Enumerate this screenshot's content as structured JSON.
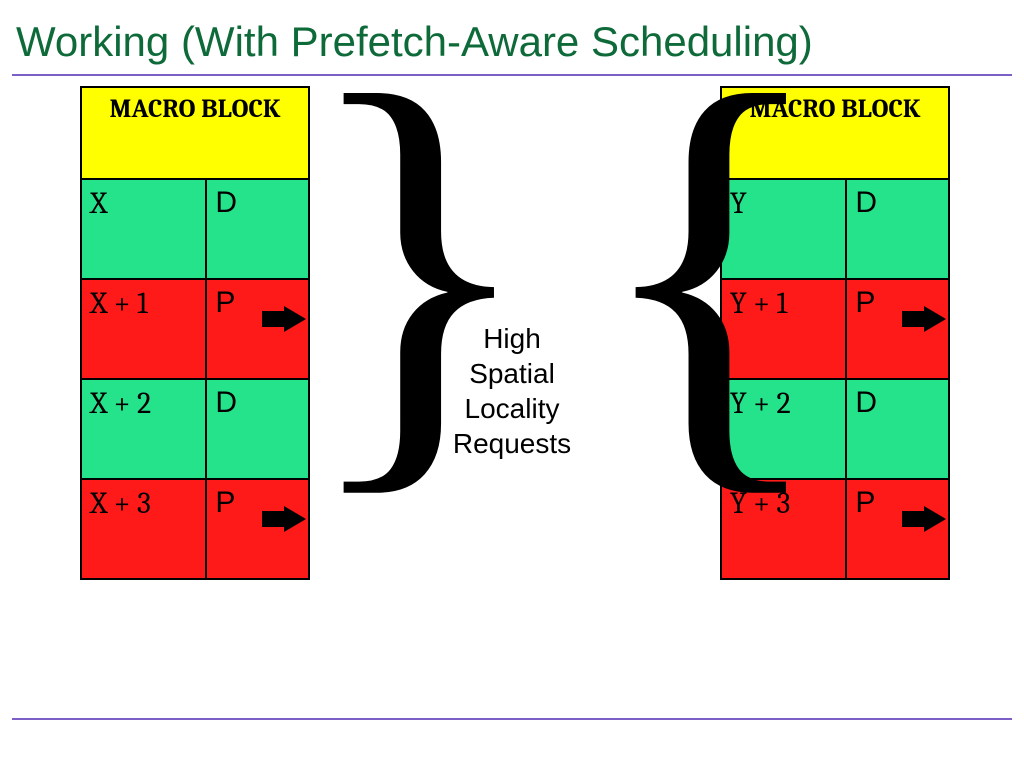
{
  "title": "Working (With Prefetch-Aware Scheduling)",
  "center_label": {
    "l1": "High",
    "l2": "Spatial",
    "l3": "Locality",
    "l4": "Requests"
  },
  "left": {
    "header": "MACRO BLOCK",
    "rows": [
      {
        "addr": "X",
        "type": "D",
        "color": "g",
        "arrow": false
      },
      {
        "addr": "X + 1",
        "type": "P",
        "color": "r",
        "arrow": true
      },
      {
        "addr": "X + 2",
        "type": "D",
        "color": "g",
        "arrow": false
      },
      {
        "addr": "X + 3",
        "type": "P",
        "color": "r",
        "arrow": true
      }
    ]
  },
  "right": {
    "header": "MACRO BLOCK",
    "rows": [
      {
        "addr": "Y",
        "type": "D",
        "color": "g",
        "arrow": false
      },
      {
        "addr": "Y + 1",
        "type": "P",
        "color": "r",
        "arrow": true
      },
      {
        "addr": "Y + 2",
        "type": "D",
        "color": "g",
        "arrow": false
      },
      {
        "addr": "Y + 3",
        "type": "P",
        "color": "r",
        "arrow": true
      }
    ]
  },
  "colors": {
    "green": "#25e38a",
    "red": "#ff1a1a",
    "yellow": "#ffff00",
    "title": "#0f6a3a"
  }
}
